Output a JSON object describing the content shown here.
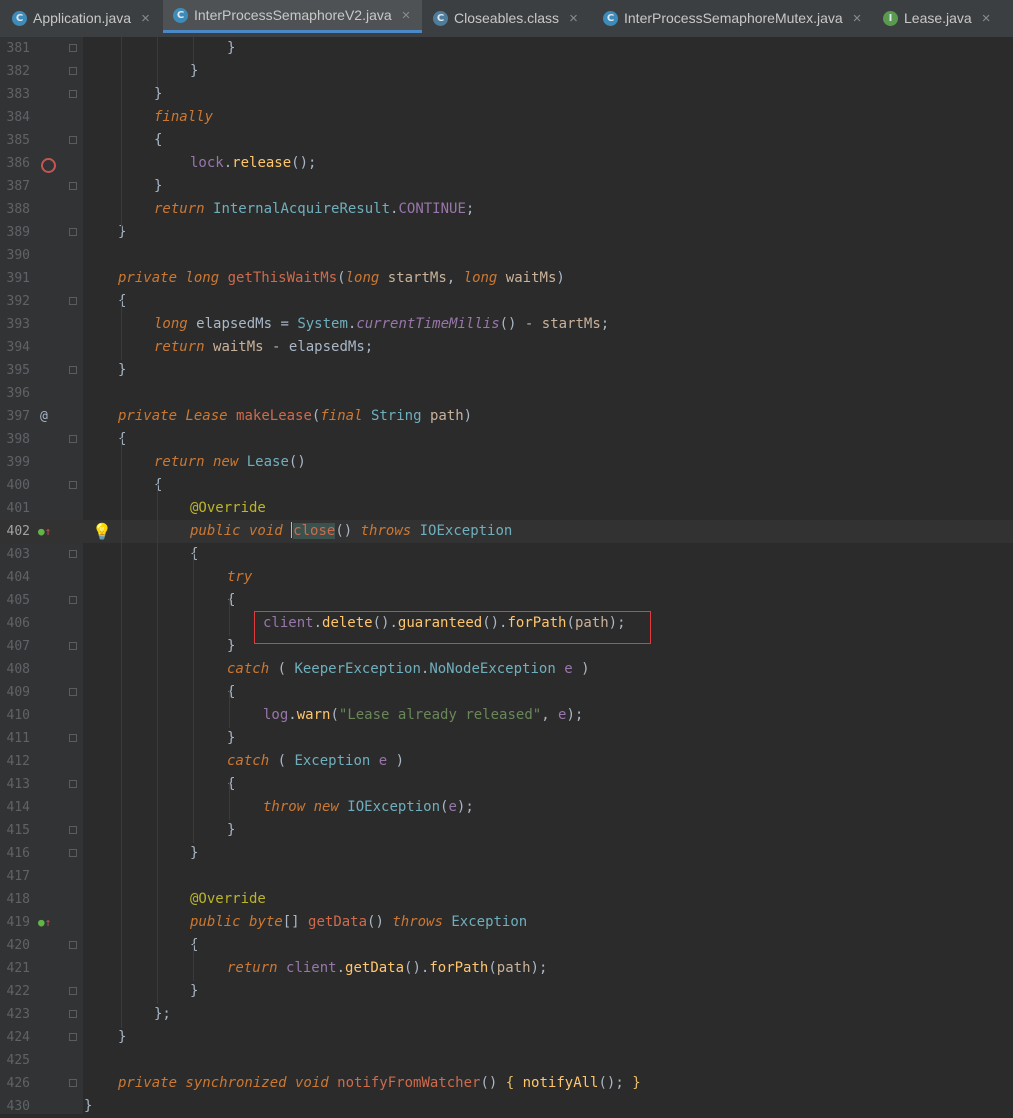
{
  "tabs": [
    {
      "label": "Application.java",
      "icon": "class-icon",
      "active": false
    },
    {
      "label": "InterProcessSemaphoreV2.java",
      "icon": "class-icon",
      "active": true
    },
    {
      "label": "Closeables.class",
      "icon": "class-icon",
      "active": false
    },
    {
      "label": "InterProcessSemaphoreMutex.java",
      "icon": "class-icon",
      "active": false
    },
    {
      "label": "Lease.java",
      "icon": "interface-icon",
      "active": false
    }
  ],
  "editor": {
    "current_line": 402,
    "line_numbers": [
      "381",
      "382",
      "383",
      "384",
      "385",
      "386",
      "387",
      "388",
      "389",
      "390",
      "391",
      "392",
      "393",
      "394",
      "395",
      "396",
      "397",
      "398",
      "399",
      "400",
      "401",
      "402",
      "403",
      "404",
      "405",
      "406",
      "407",
      "408",
      "409",
      "410",
      "411",
      "412",
      "413",
      "414",
      "415",
      "416",
      "417",
      "418",
      "419",
      "420",
      "421",
      "422",
      "423",
      "424",
      "425",
      "426",
      "430"
    ],
    "highlighted_statement": "client.delete().guaranteed().forPath(path);",
    "gutter_markers": {
      "386": "breakpoint-icon",
      "397": "at-sign-icon",
      "402": "implements-method-icon",
      "419": "implements-method-icon"
    },
    "strings": {
      "lease_released": "\"Lease already released\""
    }
  },
  "colors": {
    "background": "#2b2b2b",
    "keyword": "#cc7832",
    "string": "#6a8759",
    "annotation": "#bbb529",
    "highlight_box": "#e03c3c",
    "active_tab_underline": "#4a88c7"
  }
}
